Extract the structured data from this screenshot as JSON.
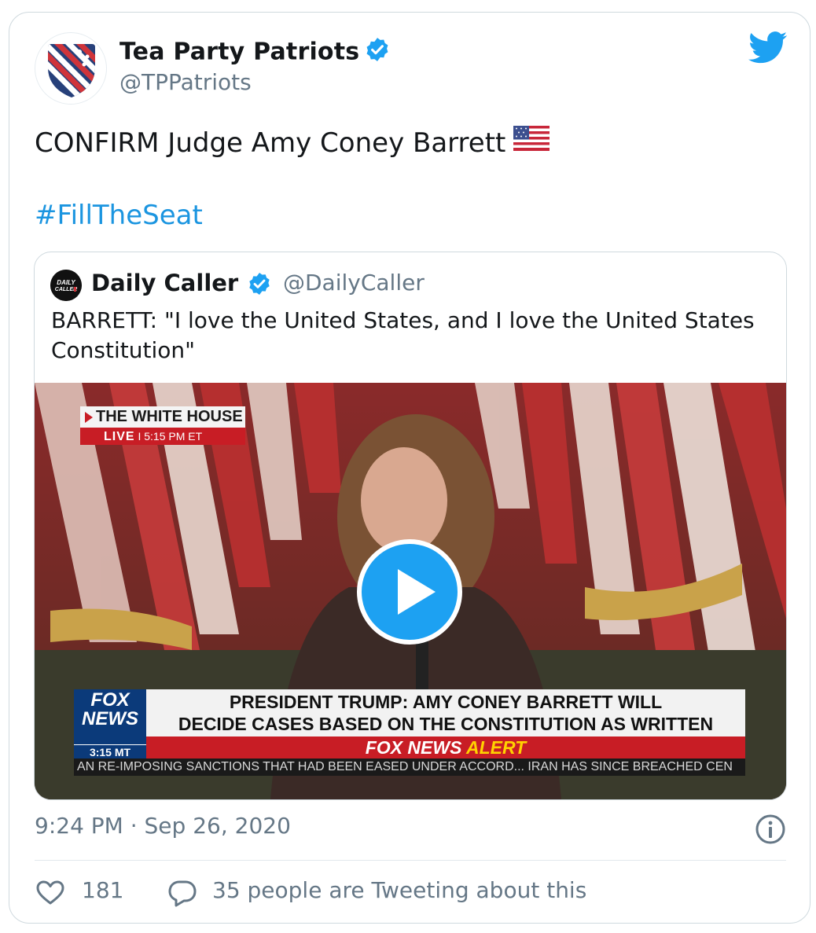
{
  "tweet": {
    "author_name": "Tea Party Patriots",
    "author_handle": "@TPPatriots",
    "text": "CONFIRM Judge Amy Coney Barrett",
    "hashtag": "#FillTheSeat",
    "timestamp": "9:24 PM · Sep 26, 2020",
    "likes": "181",
    "conversation": "35 people are Tweeting about this"
  },
  "quoted": {
    "author_name": "Daily Caller",
    "author_handle": "@DailyCaller",
    "avatar_text": "DAILY CALLER",
    "text": "BARRETT: \"I love the United States, and I love the United States Constitution\""
  },
  "video": {
    "location_label": "THE WHITE HOUSE",
    "live_label": "LIVE",
    "live_time": "I 5:15 PM ET",
    "network_logo": "FOX NEWS",
    "network_time": "3:15 MT",
    "headline_line1": "PRESIDENT TRUMP: AMY CONEY BARRETT WILL",
    "headline_line2": "DECIDE CASES BASED ON THE CONSTITUTION AS WRITTEN",
    "alert_part1": "FOX NEWS",
    "alert_part2": "ALERT",
    "ticker": "AN RE-IMPOSING SANCTIONS THAT HAD BEEN EASED UNDER ACCORD...   IRAN HAS SINCE BREACHED CEN"
  },
  "colors": {
    "link": "#1b95e0",
    "twitter_blue": "#1da1f2",
    "secondary_text": "#657786"
  }
}
